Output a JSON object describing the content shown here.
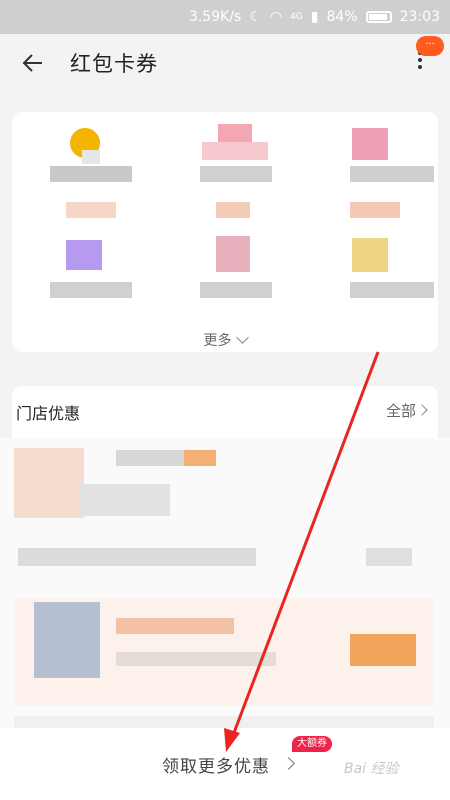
{
  "status_bar": {
    "speed": "3.59K/s",
    "network": "4G",
    "battery": "84%",
    "time": "23:03"
  },
  "header": {
    "title": "红包卡券",
    "menu_badge": "···"
  },
  "coupons": {
    "more_label": "更多"
  },
  "store_section": {
    "title": "门店优惠",
    "all_label": "全部"
  },
  "bottom_bar": {
    "get_more_label": "领取更多优惠",
    "badge": "大额券",
    "watermark": "Bai 经验"
  },
  "colors": {
    "accent": "#ff5a1f",
    "badge": "#f0224a",
    "annotation_arrow": "#e8251f"
  }
}
